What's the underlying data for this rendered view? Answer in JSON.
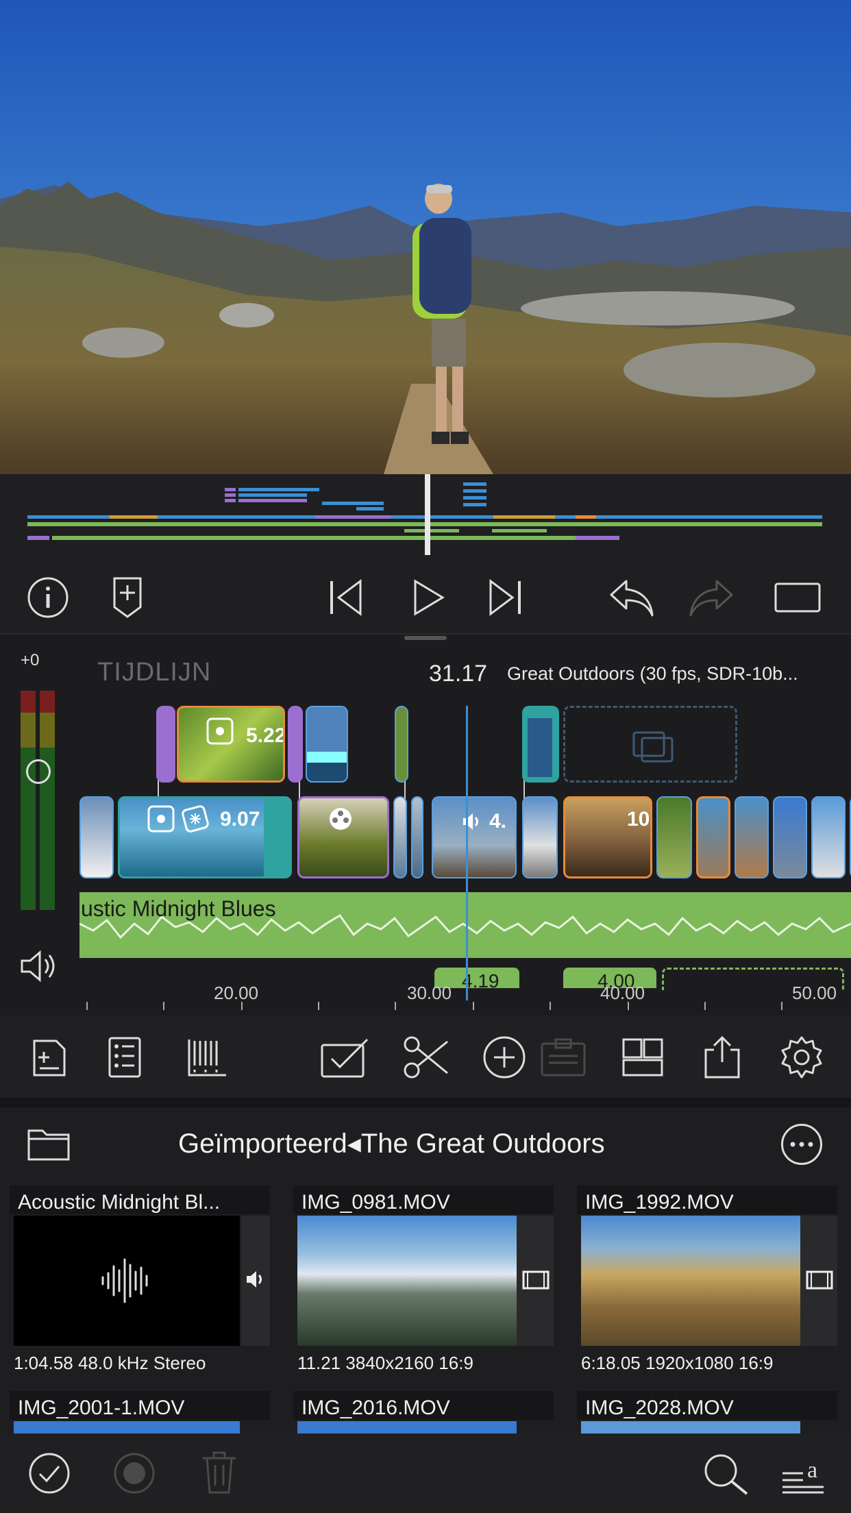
{
  "timeline": {
    "meter_offset": "+0",
    "label": "TIJDLIJN",
    "timecode": "31.17",
    "project_info": "Great Outdoors (30 fps, SDR-10b...",
    "clip_labels": {
      "clip_a": "5.22",
      "clip_b": "9.07",
      "clip_c": "4.",
      "clip_d": "10"
    },
    "audio_title": "ustic Midnight Blues",
    "sub_labels": [
      "4.19",
      "4.00"
    ],
    "ruler": [
      "20.00",
      "30.00",
      "40.00",
      "50.00"
    ]
  },
  "browser": {
    "path_folder": "Geïmporteerd",
    "path_separator": "◂",
    "path_project": "The Great Outdoors",
    "items": [
      {
        "title": "Acoustic Midnight Bl...",
        "duration": "1:04.58",
        "spec": "48.0 kHz",
        "format": "Stereo"
      },
      {
        "title": "IMG_0981.MOV",
        "duration": "11.21",
        "spec": "3840x2160",
        "format": "16:9"
      },
      {
        "title": "IMG_1992.MOV",
        "duration": "6:18.05",
        "spec": "1920x1080",
        "format": "16:9"
      },
      {
        "title": "IMG_2001-1.MOV"
      },
      {
        "title": "IMG_2016.MOV"
      },
      {
        "title": "IMG_2028.MOV"
      }
    ]
  },
  "colors": {
    "accent_blue": "#3a8fd6",
    "clip_teal": "#2fa3a0",
    "clip_purple": "#9b6fd0",
    "clip_orange": "#e98a3a",
    "audio_green": "#7db859"
  }
}
